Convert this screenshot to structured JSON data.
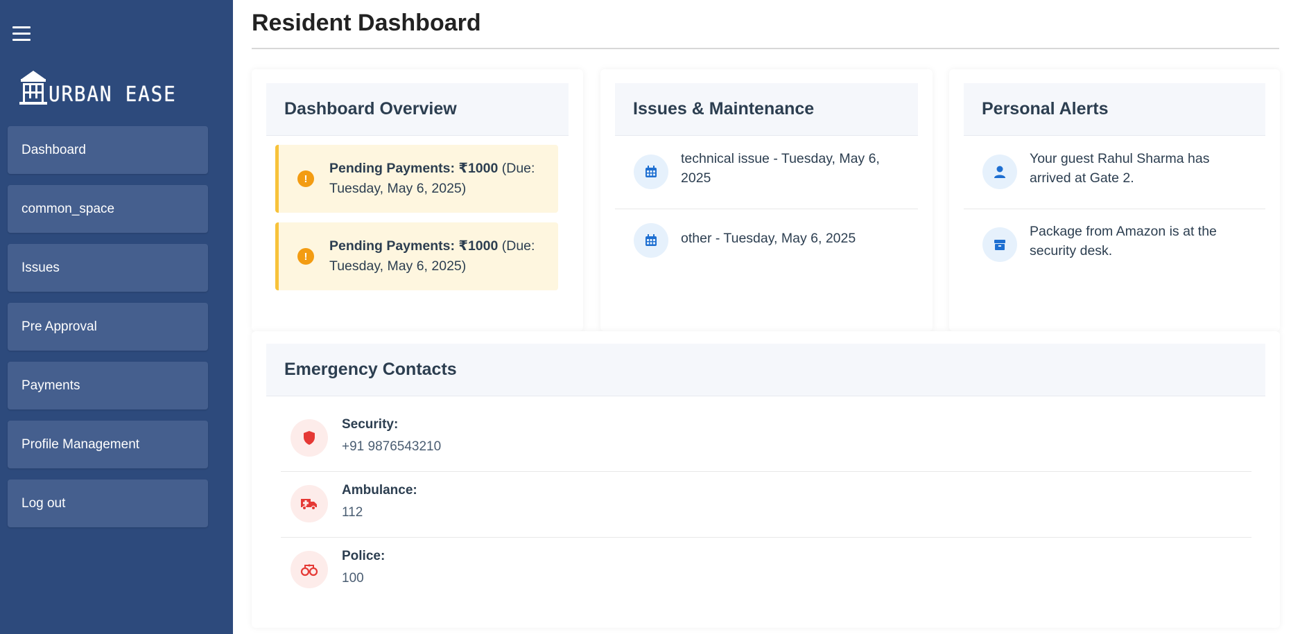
{
  "sidebar": {
    "brand": "URBAN EASE",
    "items": [
      {
        "label": "Dashboard"
      },
      {
        "label": "common_space"
      },
      {
        "label": "Issues"
      },
      {
        "label": "Pre Approval"
      },
      {
        "label": "Payments"
      },
      {
        "label": "Profile Management"
      },
      {
        "label": "Log out"
      }
    ]
  },
  "page": {
    "title": "Resident Dashboard"
  },
  "overview": {
    "title": "Dashboard Overview",
    "payments": [
      {
        "label": "Pending Payments: ₹1000",
        "due": "(Due: Tuesday, May 6, 2025)",
        "icon": "warning-icon"
      },
      {
        "label": "Pending Payments: ₹1000",
        "due": "(Due: Tuesday, May 6, 2025)",
        "icon": "warning-icon"
      }
    ]
  },
  "issues": {
    "title": "Issues & Maintenance",
    "items": [
      {
        "text": "technical issue - Tuesday, May 6, 2025",
        "icon": "calendar-icon"
      },
      {
        "text": "other - Tuesday, May 6, 2025",
        "icon": "calendar-icon"
      }
    ]
  },
  "alerts": {
    "title": "Personal Alerts",
    "items": [
      {
        "text": "Your guest Rahul Sharma has arrived at Gate 2.",
        "icon": "user-icon"
      },
      {
        "text": "Package from Amazon is at the security desk.",
        "icon": "box-icon"
      }
    ]
  },
  "emergency": {
    "title": "Emergency Contacts",
    "contacts": [
      {
        "label": "Security:",
        "value": "+91 9876543210",
        "icon": "shield-icon"
      },
      {
        "label": "Ambulance:",
        "value": "112",
        "icon": "ambulance-icon"
      },
      {
        "label": "Police:",
        "value": "100",
        "icon": "handcuffs-icon"
      }
    ]
  },
  "colors": {
    "sidebar_bg": "#2d4a7c",
    "nav_item_bg": "#455f8e",
    "warning_bg": "#fef6df",
    "warning_border": "#f7c23a",
    "warning_icon": "#f39c12",
    "info_icon": "#1e6fd1",
    "danger_icon": "#e53935"
  }
}
